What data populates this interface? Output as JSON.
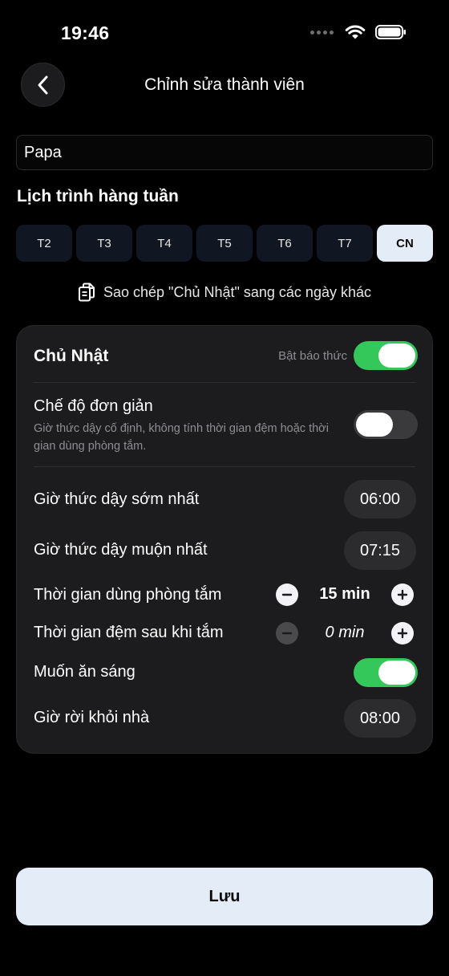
{
  "status_bar": {
    "time": "19:46"
  },
  "header": {
    "title": "Chỉnh sửa thành viên"
  },
  "member": {
    "name": "Papa"
  },
  "schedule": {
    "section_title": "Lịch trình hàng tuần",
    "days": [
      {
        "label": "T2",
        "active": false
      },
      {
        "label": "T3",
        "active": false
      },
      {
        "label": "T4",
        "active": false
      },
      {
        "label": "T5",
        "active": false
      },
      {
        "label": "T6",
        "active": false
      },
      {
        "label": "T7",
        "active": false
      },
      {
        "label": "CN",
        "active": true
      }
    ],
    "copy_label": "Sao chép \"Chủ Nhật\" sang các ngày khác"
  },
  "card": {
    "day_name": "Chủ Nhật",
    "alarm_label": "Bật báo thức",
    "alarm_on": true,
    "simple_mode": {
      "title": "Chế độ đơn giản",
      "description": "Giờ thức dậy cố định, không tính thời gian đệm hoặc thời gian dùng phòng tắm.",
      "on": false
    },
    "earliest_wake": {
      "label": "Giờ thức dậy sớm nhất",
      "value": "06:00"
    },
    "latest_wake": {
      "label": "Giờ thức dậy muộn nhất",
      "value": "07:15"
    },
    "bathroom_time": {
      "label": "Thời gian dùng phòng tắm",
      "value": "15 min"
    },
    "buffer_time": {
      "label": "Thời gian đệm sau khi tắm",
      "value": "0 min"
    },
    "breakfast": {
      "label": "Muốn ăn sáng",
      "on": true
    },
    "leave_home": {
      "label": "Giờ rời khỏi nhà",
      "value": "08:00"
    }
  },
  "save_label": "Lưu",
  "colors": {
    "accent_green": "#34c759",
    "active_day": "#e3ecf7",
    "card_bg": "#1c1c1e"
  }
}
